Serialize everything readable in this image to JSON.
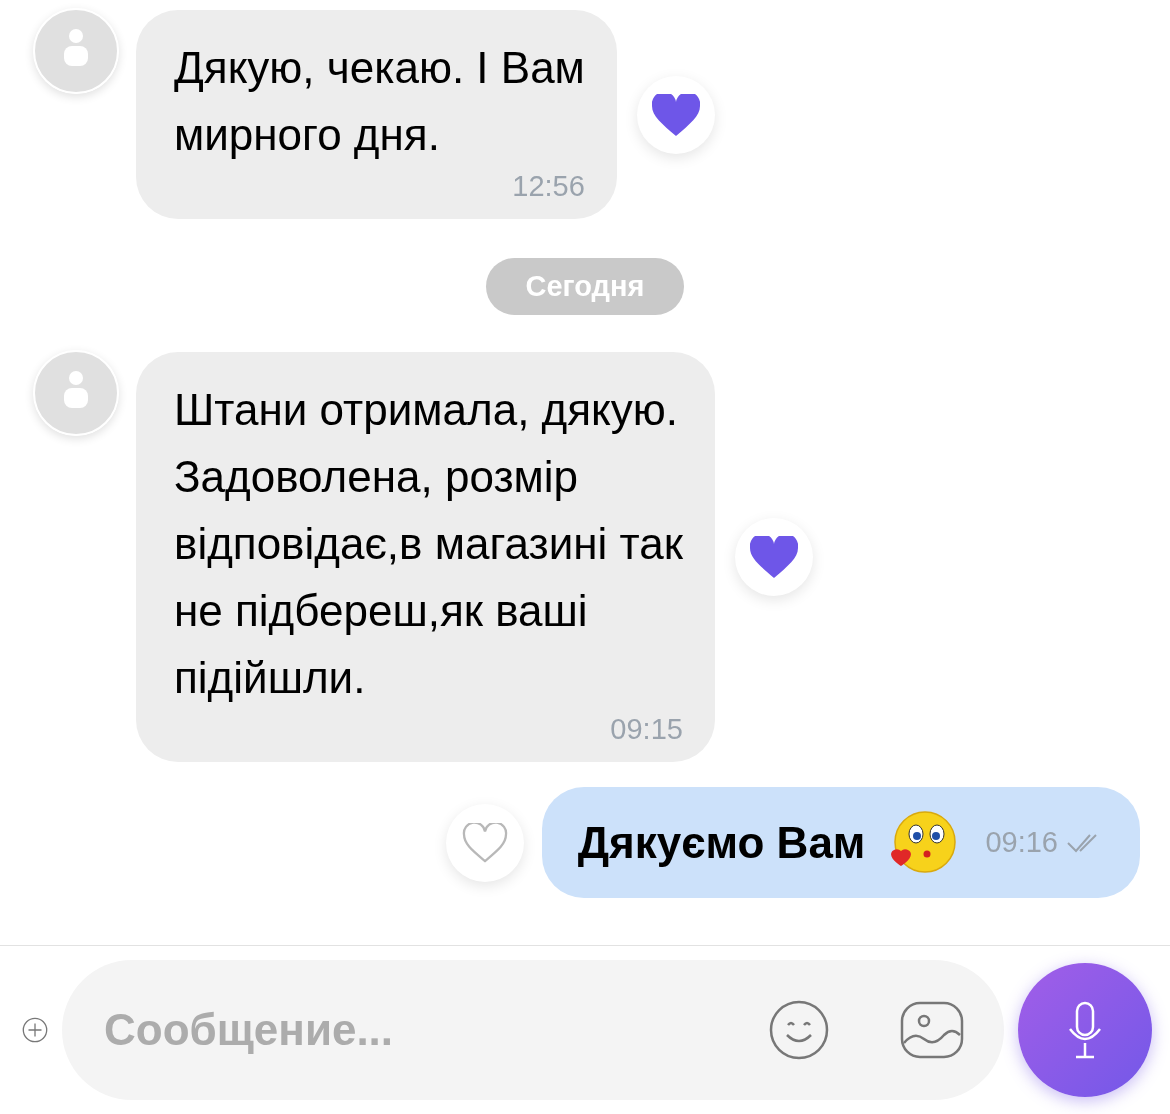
{
  "messages": [
    {
      "kind": "incoming",
      "text": "Дякую, чекаю. І Вам\nмирного дня.",
      "time": "12:56",
      "liked": true
    },
    {
      "kind": "date",
      "text": "Сегодня"
    },
    {
      "kind": "incoming",
      "text": "Штани отримала, дякую.\nЗадоволена, розмір\nвідповідає,в магазині так\nне підбереш,як ваші\nпідійшли.",
      "time": "09:15",
      "liked": true
    },
    {
      "kind": "outgoing",
      "text": "Дякуємо Вам",
      "time": "09:16",
      "liked": false,
      "read": true
    }
  ],
  "composer": {
    "placeholder": "Сообщение..."
  }
}
